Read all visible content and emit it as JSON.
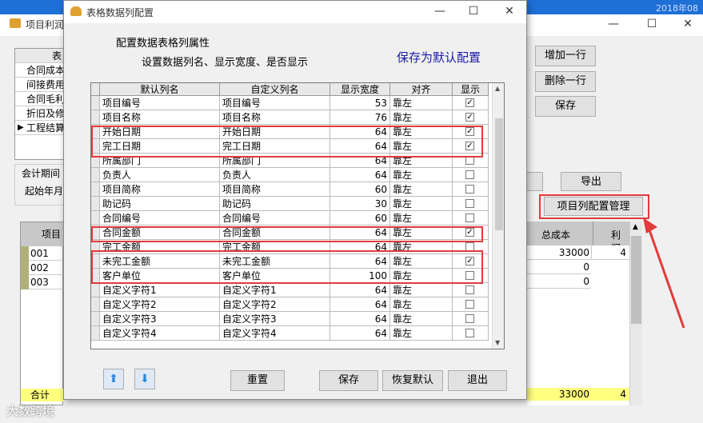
{
  "background": {
    "title": "项目利润",
    "year_hint": "2018年08",
    "window_controls": [
      "—",
      "☐",
      "✕"
    ],
    "left_table": {
      "header": "表",
      "rows": [
        "合同成本",
        "间接费用",
        "合同毛利",
        "折旧及修",
        "工程结算"
      ]
    },
    "period_label": "会计期间",
    "start_label": "起始年月",
    "buttons": {
      "add_row": "增加一行",
      "delete_row": "删除一行",
      "save": "保存",
      "export": "导出",
      "col_config": "项目列配置管理"
    },
    "data_table": {
      "col_header": "项目",
      "rows": [
        "001",
        "002",
        "003"
      ],
      "total_label": "合计",
      "right_headers": [
        "总成本",
        "利润"
      ],
      "right_values": [
        [
          "33000",
          "4"
        ],
        [
          "0",
          ""
        ],
        [
          "0",
          ""
        ]
      ],
      "total_values": [
        "33000",
        "4"
      ]
    },
    "watermark": "大数跨境"
  },
  "dialog": {
    "title": "表格数据列配置",
    "controls": [
      "—",
      "☐",
      "✕"
    ],
    "heading": "配置数据表格列属性",
    "subheading": "设置数据列名、显示宽度、是否显示",
    "save_default_link": "保存为默认配置",
    "columns": [
      "默认列名",
      "自定义列名",
      "显示宽度",
      "对齐",
      "显示"
    ],
    "rows": [
      {
        "default": "项目编号",
        "custom": "项目编号",
        "width": "53",
        "align": "靠左",
        "show": true
      },
      {
        "default": "项目名称",
        "custom": "项目名称",
        "width": "76",
        "align": "靠左",
        "show": true
      },
      {
        "default": "开始日期",
        "custom": "开始日期",
        "width": "64",
        "align": "靠左",
        "show": true
      },
      {
        "default": "完工日期",
        "custom": "完工日期",
        "width": "64",
        "align": "靠左",
        "show": true
      },
      {
        "default": "所属部门",
        "custom": "所属部门",
        "width": "64",
        "align": "靠左",
        "show": false
      },
      {
        "default": "负责人",
        "custom": "负责人",
        "width": "64",
        "align": "靠左",
        "show": false
      },
      {
        "default": "项目简称",
        "custom": "项目简称",
        "width": "60",
        "align": "靠左",
        "show": false
      },
      {
        "default": "助记码",
        "custom": "助记码",
        "width": "30",
        "align": "靠左",
        "show": false
      },
      {
        "default": "合同编号",
        "custom": "合同编号",
        "width": "60",
        "align": "靠左",
        "show": false
      },
      {
        "default": "合同金额",
        "custom": "合同金额",
        "width": "64",
        "align": "靠左",
        "show": true
      },
      {
        "default": "完工金额",
        "custom": "完工金额",
        "width": "64",
        "align": "靠左",
        "show": false
      },
      {
        "default": "未完工金额",
        "custom": "未完工金额",
        "width": "64",
        "align": "靠左",
        "show": true
      },
      {
        "default": "客户单位",
        "custom": "客户单位",
        "width": "100",
        "align": "靠左",
        "show": false
      },
      {
        "default": "自定义字符1",
        "custom": "自定义字符1",
        "width": "64",
        "align": "靠左",
        "show": false
      },
      {
        "default": "自定义字符2",
        "custom": "自定义字符2",
        "width": "64",
        "align": "靠左",
        "show": false
      },
      {
        "default": "自定义字符3",
        "custom": "自定义字符3",
        "width": "64",
        "align": "靠左",
        "show": false
      },
      {
        "default": "自定义字符4",
        "custom": "自定义字符4",
        "width": "64",
        "align": "靠左",
        "show": false
      }
    ],
    "buttons": {
      "up_icon": "up-arrow-icon",
      "down_icon": "down-arrow-icon",
      "reset": "重置",
      "save": "保存",
      "restore": "恢复默认",
      "exit": "退出"
    },
    "highlight_color": "#e23b3b"
  }
}
